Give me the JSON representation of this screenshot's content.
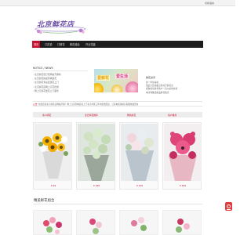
{
  "topbar": {
    "language": "切换语言"
  },
  "logo": {
    "text": "北京鲜花店"
  },
  "nav": {
    "items": [
      {
        "label": "首页",
        "active": true
      },
      {
        "label": "订花说"
      },
      {
        "label": "订鲜花"
      },
      {
        "label": "鲜花组合"
      },
      {
        "label": "开业花篮"
      }
    ]
  },
  "news": {
    "heading": "NOTICE / NEWS",
    "items": [
      "北京鲜花店订花网站开通啦",
      "北京鲜花快递同城送花",
      "北京鲜花专卖店送花上门",
      "北京鲜花店网上订花优惠",
      "网上订鲜花送花上门服务"
    ]
  },
  "banner": {
    "text_left": "爱鲜花",
    "text_right": "爱生活"
  },
  "side": {
    "title": "鲜花资讯",
    "lines": [
      "新一年到来啦",
      "值此元旦来临之际北京鲜花店",
      "感谢各位新老客户一直以来的支持",
      "本店特推出新品鲜花组合"
    ]
  },
  "ticker": {
    "label": "公告",
    "text": "热烈庆祝北京鲜花店网站开通！网上订花同城送花上门北京市区三环内免费配送，订花电话请拨打客服热线咨询"
  },
  "tabs": [
    {
      "label": "客人晒花"
    },
    {
      "label": "生日鲜花推荐"
    },
    {
      "label": "网络鲜花"
    },
    {
      "label": "客户推荐"
    }
  ],
  "products": [
    {
      "price": "¥ 99"
    },
    {
      "price": "¥ 188"
    },
    {
      "price": "¥ 158"
    },
    {
      "price": "¥ 399"
    }
  ],
  "section": {
    "title": "精美鲜花组合"
  },
  "colors": {
    "brand_red": "#c8102e",
    "nav_bg": "#1c1c1c",
    "logo_purple": "#6b4ea8"
  }
}
